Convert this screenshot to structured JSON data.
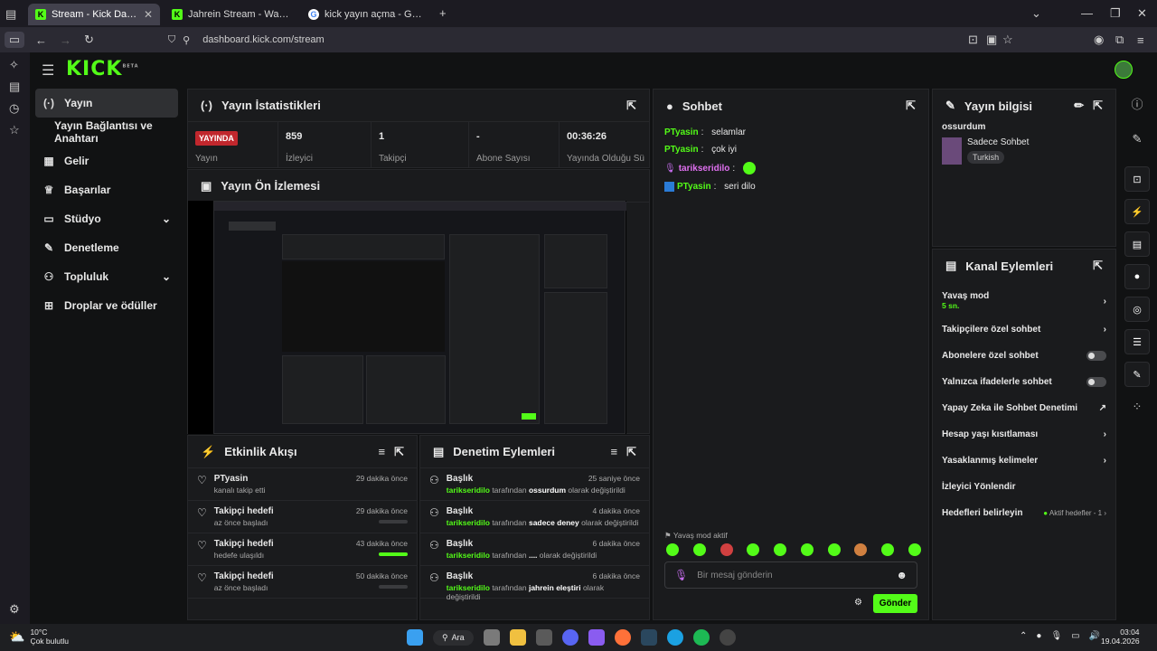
{
  "browser": {
    "tabs": [
      {
        "label": "Stream - Kick Dashboard"
      },
      {
        "label": "Jahrein Stream - Watch Live on"
      },
      {
        "label": "kick yayın açma - Google'da Ara"
      }
    ],
    "url": "dashboard.kick.com/stream"
  },
  "kick": {
    "logo": "KICK",
    "beta": "BETA",
    "nav": [
      {
        "label": "Yayın"
      },
      {
        "label": "Yayın Bağlantısı ve Anahtarı"
      },
      {
        "label": "Gelir"
      },
      {
        "label": "Başarılar"
      },
      {
        "label": "Stüdyo"
      },
      {
        "label": "Denetleme"
      },
      {
        "label": "Topluluk"
      },
      {
        "label": "Droplar ve ödüller"
      }
    ]
  },
  "stats": {
    "title": "Yayın İstatistikleri",
    "live_badge": "YAYINDA",
    "live_label": "Yayın",
    "items": [
      {
        "value": "859",
        "label": "İzleyici"
      },
      {
        "value": "1",
        "label": "Takipçi"
      },
      {
        "value": "-",
        "label": "Abone Sayısı"
      },
      {
        "value": "00:36:26",
        "label": "Yayında Olduğu Sü"
      }
    ]
  },
  "preview": {
    "title": "Yayın Ön İzlemesi"
  },
  "activity": {
    "title": "Etkinlik Akışı",
    "rows": [
      {
        "title": "PTyasin",
        "sub": "kanalı takip etti",
        "time": "29 dakika önce",
        "progress": null
      },
      {
        "title": "Takipçi hedefi",
        "sub": "az önce başladı",
        "time": "29 dakika önce",
        "progress": 0
      },
      {
        "title": "Takipçi hedefi",
        "sub": "hedefe ulaşıldı",
        "time": "43 dakika önce",
        "progress": 1
      },
      {
        "title": "Takipçi hedefi",
        "sub": "az önce başladı",
        "time": "50 dakika önce",
        "progress": 0
      }
    ]
  },
  "moderation": {
    "title": "Denetim Eylemleri",
    "rows": [
      {
        "title": "Başlık",
        "user": "tarikseridilo",
        "mid": " tarafından ",
        "value": "ossurdum",
        "end": " olarak değiştirildi",
        "time": "25 saniye önce"
      },
      {
        "title": "Başlık",
        "user": "tarikseridilo",
        "mid": " tarafından ",
        "value": "sadece deney",
        "end": " olarak değiştirildi",
        "time": "4 dakika önce"
      },
      {
        "title": "Başlık",
        "user": "tarikseridilo",
        "mid": " tarafından ",
        "value": "....",
        "end": " olarak değiştirildi",
        "time": "6 dakika önce"
      },
      {
        "title": "Başlık",
        "user": "tarikseridilo",
        "mid": " tarafından ",
        "value": "jahrein eleştiri",
        "end": " olarak değiştirildi",
        "time": "6 dakika önce"
      }
    ]
  },
  "chat": {
    "title": "Sohbet",
    "messages": [
      {
        "user": "PTyasin",
        "text": "selamlar"
      },
      {
        "user": "PTyasin",
        "text": "çok iyi"
      },
      {
        "user": "tarikseridilo",
        "text": ""
      },
      {
        "user": "PTyasin",
        "text": "seri dilo"
      }
    ],
    "slow_mode": "Yavaş mod aktif",
    "placeholder": "Bir mesaj gönderin",
    "send": "Gönder"
  },
  "info": {
    "title": "Yayın bilgisi",
    "stream_title": "ossurdum",
    "category": "Sadece Sohbet",
    "language": "Turkish"
  },
  "channel_actions": {
    "title": "Kanal Eylemleri",
    "items": [
      {
        "label": "Yavaş mod",
        "sub": "5 sn."
      },
      {
        "label": "Takipçilere özel sohbet"
      },
      {
        "label": "Abonelere özel sohbet"
      },
      {
        "label": "Yalnızca ifadelerle sohbet"
      },
      {
        "label": "Yapay Zeka ile Sohbet Denetimi"
      },
      {
        "label": "Hesap yaşı kısıtlaması"
      },
      {
        "label": "Yasaklanmış kelimeler"
      },
      {
        "label": "İzleyici Yönlendir"
      },
      {
        "label": "Hedefleri belirleyin",
        "extra": "Aktif hedefler - 1"
      }
    ]
  },
  "taskbar": {
    "weather_temp": "10°C",
    "weather_desc": "Çok bulutlu",
    "search": "Ara",
    "time": "03:04",
    "date": "19.04.2026"
  }
}
